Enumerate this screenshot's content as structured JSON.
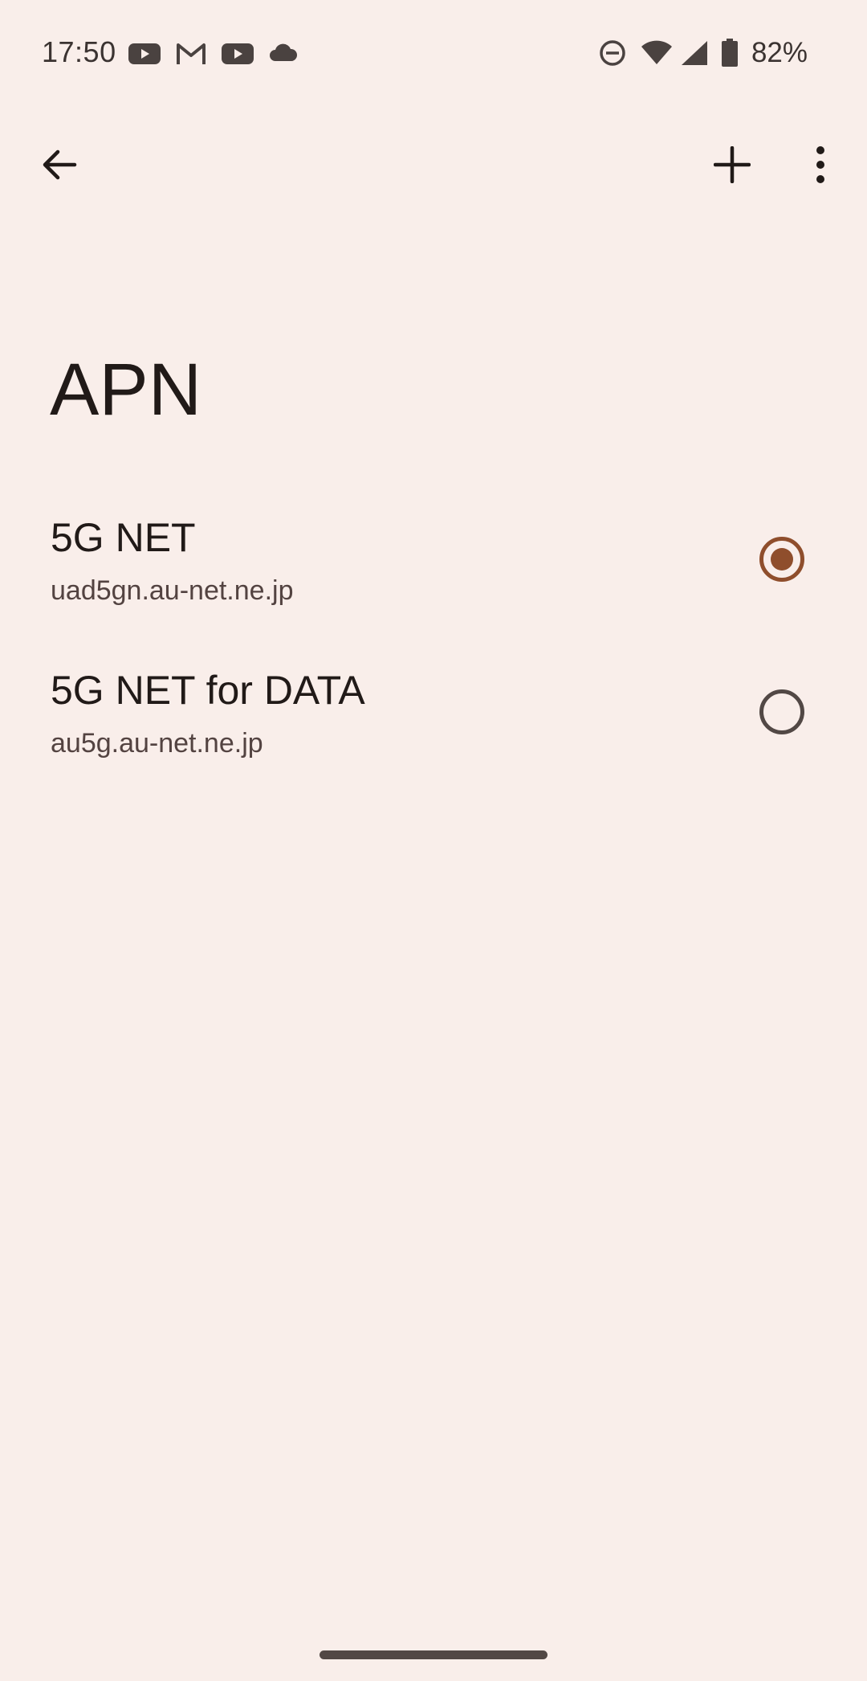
{
  "status_bar": {
    "time": "17:50",
    "notification_icons": [
      "youtube-icon",
      "gmail-icon",
      "youtube-icon",
      "cloud-icon"
    ],
    "system_icons": [
      "do-not-disturb-icon",
      "wifi-icon",
      "signal-icon",
      "battery-icon"
    ],
    "battery_percent": "82%"
  },
  "toolbar": {
    "back_icon": "arrow-back-icon",
    "add_icon": "plus-icon",
    "more_icon": "more-vert-icon"
  },
  "page": {
    "title": "APN"
  },
  "apns": [
    {
      "name": "5G NET",
      "apn": "uad5gn.au-net.ne.jp",
      "selected": true
    },
    {
      "name": "5G NET for DATA",
      "apn": "au5g.au-net.ne.jp",
      "selected": false
    }
  ],
  "colors": {
    "background": "#f9eeea",
    "accent": "#8f4e2c",
    "text_primary": "#211a18",
    "text_secondary": "#534341"
  }
}
